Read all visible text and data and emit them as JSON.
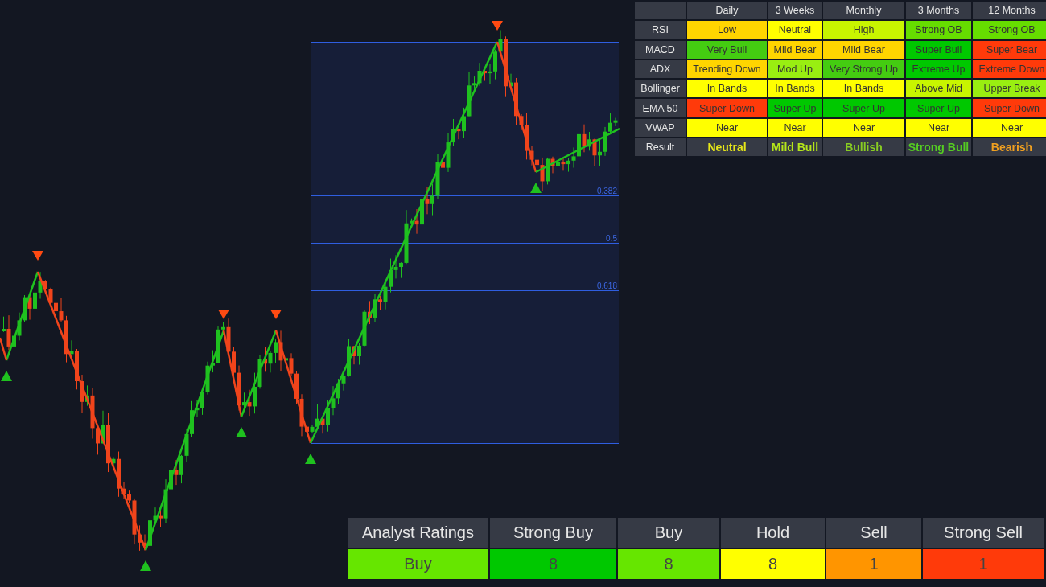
{
  "chart": {
    "fib_levels": [
      "0.382",
      "0.5",
      "0.618"
    ]
  },
  "indicator_table": {
    "columns": [
      "Daily",
      "3 Weeks",
      "Monthly",
      "3 Months",
      "12 Months"
    ],
    "rows": [
      {
        "label": "RSI",
        "kind": "cells",
        "cells": [
          {
            "text": "Low",
            "color": "#ffd500"
          },
          {
            "text": "Neutral",
            "color": "#ffff00"
          },
          {
            "text": "High",
            "color": "#c8f500"
          },
          {
            "text": "Strong OB",
            "color": "#66dd00"
          },
          {
            "text": "Strong OB",
            "color": "#66dd00"
          }
        ]
      },
      {
        "label": "MACD",
        "kind": "cells",
        "cells": [
          {
            "text": "Very Bull",
            "color": "#44cc11"
          },
          {
            "text": "Mild Bear",
            "color": "#ffd500"
          },
          {
            "text": "Mild Bear",
            "color": "#ffd500"
          },
          {
            "text": "Super Bull",
            "color": "#00c800"
          },
          {
            "text": "Super Bear",
            "color": "#ff3a0a"
          }
        ]
      },
      {
        "label": "ADX",
        "kind": "cells",
        "cells": [
          {
            "text": "Trending Down",
            "color": "#ffd500"
          },
          {
            "text": "Mod Up",
            "color": "#99ee11"
          },
          {
            "text": "Very Strong Up",
            "color": "#44cc11"
          },
          {
            "text": "Extreme Up",
            "color": "#00c800"
          },
          {
            "text": "Extreme Down",
            "color": "#ff3a0a"
          }
        ]
      },
      {
        "label": "Bollinger",
        "kind": "cells",
        "cells": [
          {
            "text": "In Bands",
            "color": "#ffff00"
          },
          {
            "text": "In Bands",
            "color": "#ffff00"
          },
          {
            "text": "In Bands",
            "color": "#ffff00"
          },
          {
            "text": "Above Mid",
            "color": "#c8f500"
          },
          {
            "text": "Upper Break",
            "color": "#99ee11"
          }
        ]
      },
      {
        "label": "EMA 50",
        "kind": "cells",
        "cells": [
          {
            "text": "Super Down",
            "color": "#ff3a0a"
          },
          {
            "text": "Super Up",
            "color": "#00c800"
          },
          {
            "text": "Super Up",
            "color": "#00c800"
          },
          {
            "text": "Super Up",
            "color": "#00c800"
          },
          {
            "text": "Super Down",
            "color": "#ff3a0a"
          }
        ]
      },
      {
        "label": "VWAP",
        "kind": "cells",
        "cells": [
          {
            "text": "Near",
            "color": "#ffff00"
          },
          {
            "text": "Near",
            "color": "#ffff00"
          },
          {
            "text": "Near",
            "color": "#ffff00"
          },
          {
            "text": "Near",
            "color": "#ffff00"
          },
          {
            "text": "Near",
            "color": "#ffff00"
          }
        ]
      },
      {
        "label": "Result",
        "kind": "result",
        "cells": [
          {
            "text": "Neutral",
            "color": "#e6e619"
          },
          {
            "text": "Mild Bull",
            "color": "#b5e61a"
          },
          {
            "text": "Bullish",
            "color": "#88cc22"
          },
          {
            "text": "Strong Bull",
            "color": "#55cc22"
          },
          {
            "text": "Bearish",
            "color": "#f0a020"
          }
        ]
      }
    ]
  },
  "analyst_ratings": {
    "columns": [
      "Analyst Ratings",
      "Strong Buy",
      "Buy",
      "Hold",
      "Sell",
      "Strong Sell"
    ],
    "values": [
      {
        "text": "Buy",
        "color": "#66e600"
      },
      {
        "text": "8",
        "color": "#00c800"
      },
      {
        "text": "8",
        "color": "#66e600"
      },
      {
        "text": "8",
        "color": "#ffff00"
      },
      {
        "text": "1",
        "color": "#ff9500"
      },
      {
        "text": "1",
        "color": "#ff3a0a"
      }
    ]
  }
}
